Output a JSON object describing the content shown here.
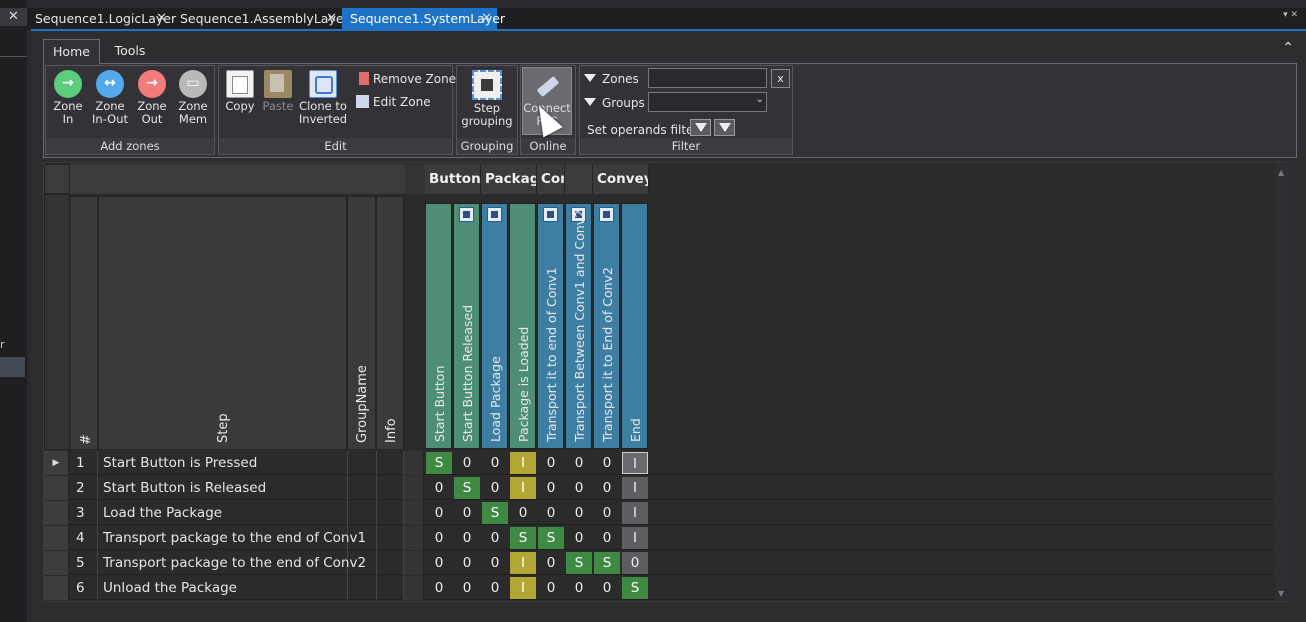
{
  "document_tabs": [
    {
      "label": "Sequence1.LogicLayer",
      "active": false
    },
    {
      "label": "Sequence1.AssemblyLayer",
      "active": false
    },
    {
      "label": "Sequence1.SystemLayer",
      "active": true
    }
  ],
  "left_strip": {
    "close_glyph": "✕",
    "partial_letter": "r"
  },
  "tab_overflow_glyph": "▾ ✕",
  "ribbon": {
    "tabs": {
      "home": "Home",
      "tools": "Tools"
    },
    "collapse_glyph": "⌃",
    "add_zones": {
      "label": "Add zones",
      "zone_in": {
        "line1": "Zone",
        "line2": "In"
      },
      "zone_in_out": {
        "line1": "Zone",
        "line2": "In-Out"
      },
      "zone_out": {
        "line1": "Zone",
        "line2": "Out"
      },
      "zone_mem": {
        "line1": "Zone",
        "line2": "Mem"
      }
    },
    "edit": {
      "label": "Edit",
      "copy": "Copy",
      "paste": "Paste",
      "clone": {
        "line1": "Clone to",
        "line2": "Inverted"
      },
      "remove_zone": "Remove Zone",
      "edit_zone": "Edit Zone"
    },
    "grouping": {
      "label": "Grouping",
      "step": {
        "line1": "Step",
        "line2": "grouping"
      }
    },
    "online": {
      "label": "Online",
      "connect": {
        "line1": "Connect",
        "line2": "PLC"
      }
    },
    "filter": {
      "label": "Filter",
      "zones_label": "Zones",
      "groups_label": "Groups",
      "clear_label": "x",
      "operands_label": "Set operands filter",
      "zones_value": "",
      "groups_value": ""
    }
  },
  "grid": {
    "column_headers": {
      "num": "#",
      "step": "Step",
      "group": "GroupName",
      "info": "Info"
    },
    "group_headers": [
      "Button",
      "Package",
      "Conv",
      "",
      "Convey"
    ],
    "operands": [
      {
        "label": "Start Button",
        "color": "#4e8e74",
        "badge": false
      },
      {
        "label": "Start Button Released",
        "color": "#4e8e74",
        "badge": true
      },
      {
        "label": "Load Package",
        "color": "#3f7ea3",
        "badge": true
      },
      {
        "label": "Package is Loaded",
        "color": "#4e8e74",
        "badge": false
      },
      {
        "label": "Transport it to end of Conv1",
        "color": "#3f7ea3",
        "badge": true
      },
      {
        "label": "Transport Between Conv1 and Conv2",
        "color": "#3f7ea3",
        "badge": true
      },
      {
        "label": "Transport it to End of Conv2",
        "color": "#3f7ea3",
        "badge": true
      },
      {
        "label": "End",
        "color": "#3f7ea3",
        "badge": false
      }
    ],
    "rows": [
      {
        "num": "1",
        "step": "Start Button is Pressed",
        "values": [
          "S",
          "0",
          "0",
          "I",
          "0",
          "0",
          "0",
          "I"
        ],
        "current": true
      },
      {
        "num": "2",
        "step": "Start Button is Released",
        "values": [
          "0",
          "S",
          "0",
          "I",
          "0",
          "0",
          "0",
          "I"
        ],
        "current": false
      },
      {
        "num": "3",
        "step": "Load the Package",
        "values": [
          "0",
          "0",
          "S",
          "0",
          "0",
          "0",
          "0",
          "I"
        ],
        "current": false
      },
      {
        "num": "4",
        "step": "Transport package to the end of Conv1",
        "values": [
          "0",
          "0",
          "0",
          "S",
          "S",
          "0",
          "0",
          "I"
        ],
        "current": false
      },
      {
        "num": "5",
        "step": "Transport package to the end of Conv2",
        "values": [
          "0",
          "0",
          "0",
          "I",
          "0",
          "S",
          "S",
          "0"
        ],
        "current": false
      },
      {
        "num": "6",
        "step": "Unload the Package",
        "values": [
          "0",
          "0",
          "0",
          "I",
          "0",
          "0",
          "0",
          "S"
        ],
        "current": false
      }
    ],
    "current_row_glyph": "▶"
  }
}
